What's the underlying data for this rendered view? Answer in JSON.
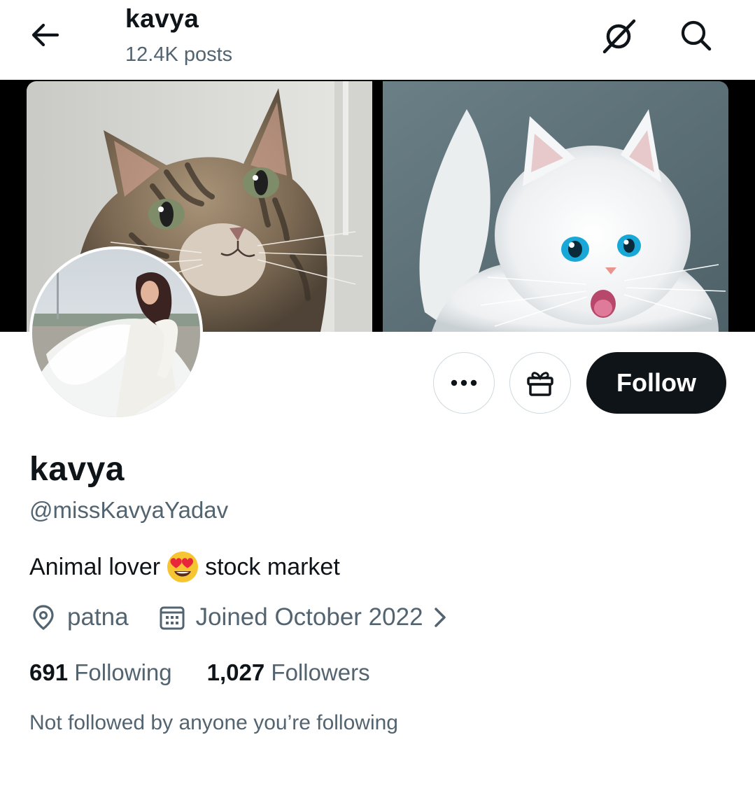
{
  "header": {
    "title": "kavya",
    "posts": "12.4K posts",
    "back_icon": "arrow-left-icon",
    "grok_icon": "grok-icon",
    "search_icon": "search-icon"
  },
  "profile": {
    "display_name": "kavya",
    "handle": "@missKavyaYadav",
    "bio_part1": "Animal lover",
    "bio_emoji": "heart-eyes-emoji",
    "bio_part2": "stock market",
    "location": "patna",
    "joined": "Joined October 2022",
    "following_count": "691",
    "following_label": "Following",
    "followers_count": "1,027",
    "followers_label": "Followers",
    "not_followed": "Not followed by anyone you’re following"
  },
  "actions": {
    "more_icon": "more-icon",
    "gift_icon": "gift-icon",
    "follow_label": "Follow"
  },
  "colors": {
    "text_primary": "#0f1419",
    "text_secondary": "#536471",
    "follow_bg": "#0f1419",
    "border": "#cfd9de"
  }
}
